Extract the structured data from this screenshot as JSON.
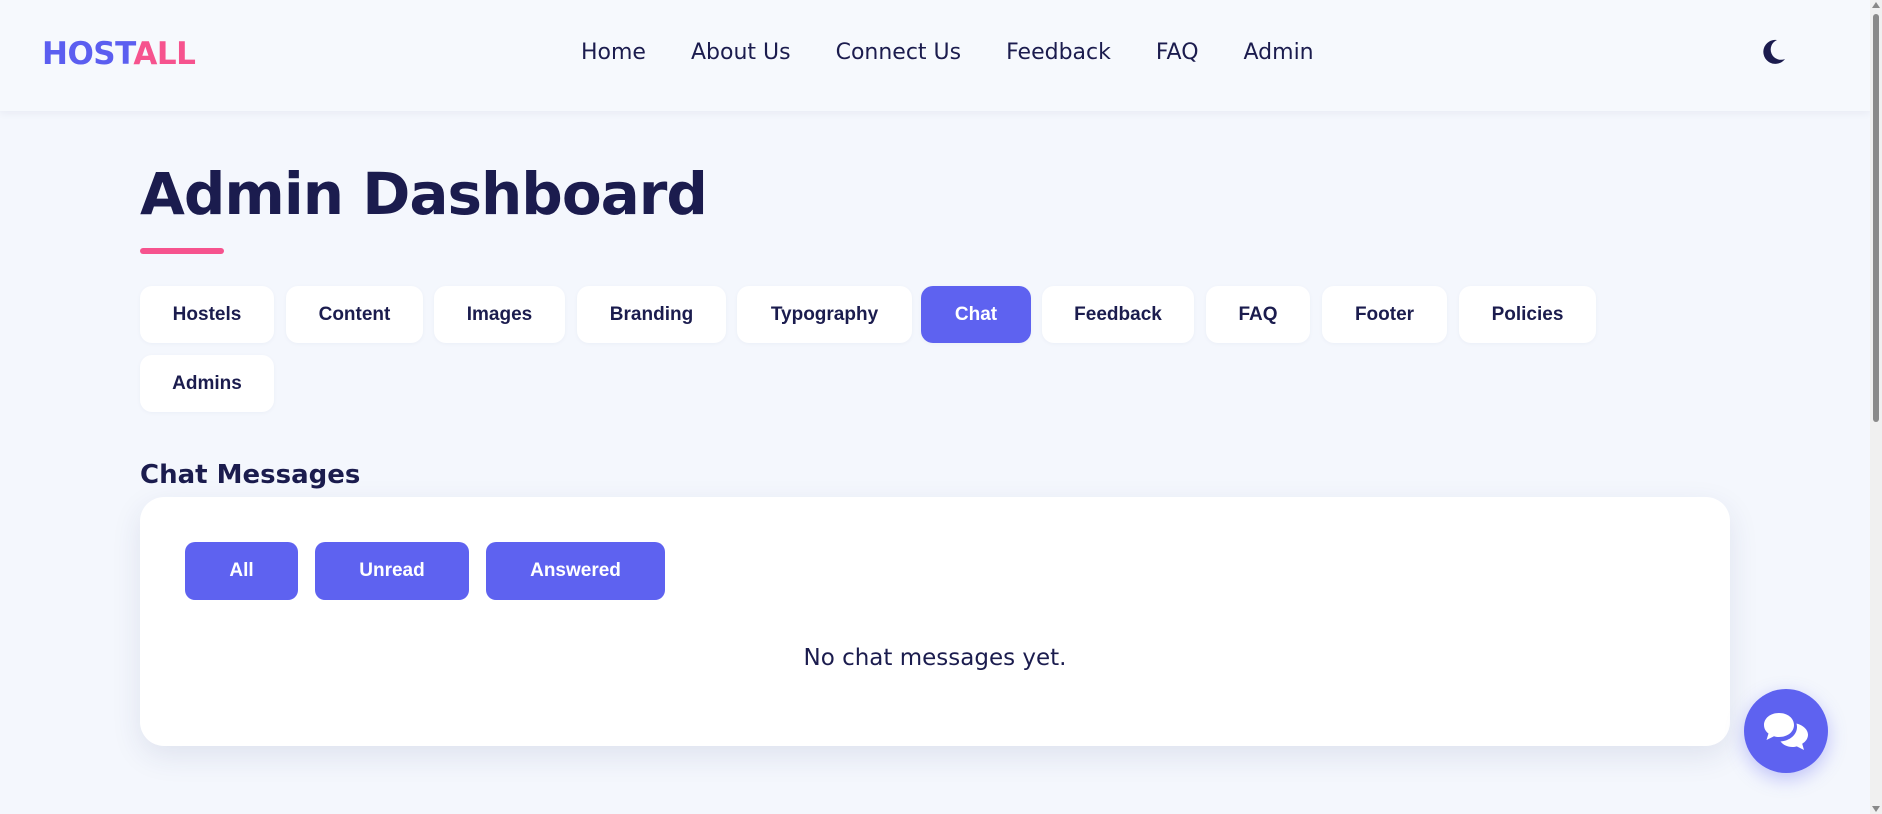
{
  "header": {
    "logo_part1": "HOST",
    "logo_part2": "ALL",
    "nav": [
      "Home",
      "About Us",
      "Connect Us",
      "Feedback",
      "FAQ",
      "Admin"
    ],
    "theme_icon": "moon-icon"
  },
  "main": {
    "title": "Admin Dashboard",
    "tabs": [
      {
        "label": "Hostels",
        "active": false
      },
      {
        "label": "Content",
        "active": false
      },
      {
        "label": "Images",
        "active": false
      },
      {
        "label": "Branding",
        "active": false
      },
      {
        "label": "Typography",
        "active": false
      },
      {
        "label": "Chat",
        "active": true
      },
      {
        "label": "Feedback",
        "active": false
      },
      {
        "label": "FAQ",
        "active": false
      },
      {
        "label": "Footer",
        "active": false
      },
      {
        "label": "Policies",
        "active": false
      },
      {
        "label": "Admins",
        "active": false
      }
    ],
    "section_title": "Chat Messages",
    "filters": [
      "All",
      "Unread",
      "Answered"
    ],
    "empty_message": "No chat messages yet."
  },
  "chat_widget": {
    "icon": "chat-bubbles-icon"
  },
  "colors": {
    "accent": "#5e62f0",
    "brand_pink": "#f6538e",
    "text_dark": "#1b1c4e",
    "background": "#f4f7fd"
  }
}
